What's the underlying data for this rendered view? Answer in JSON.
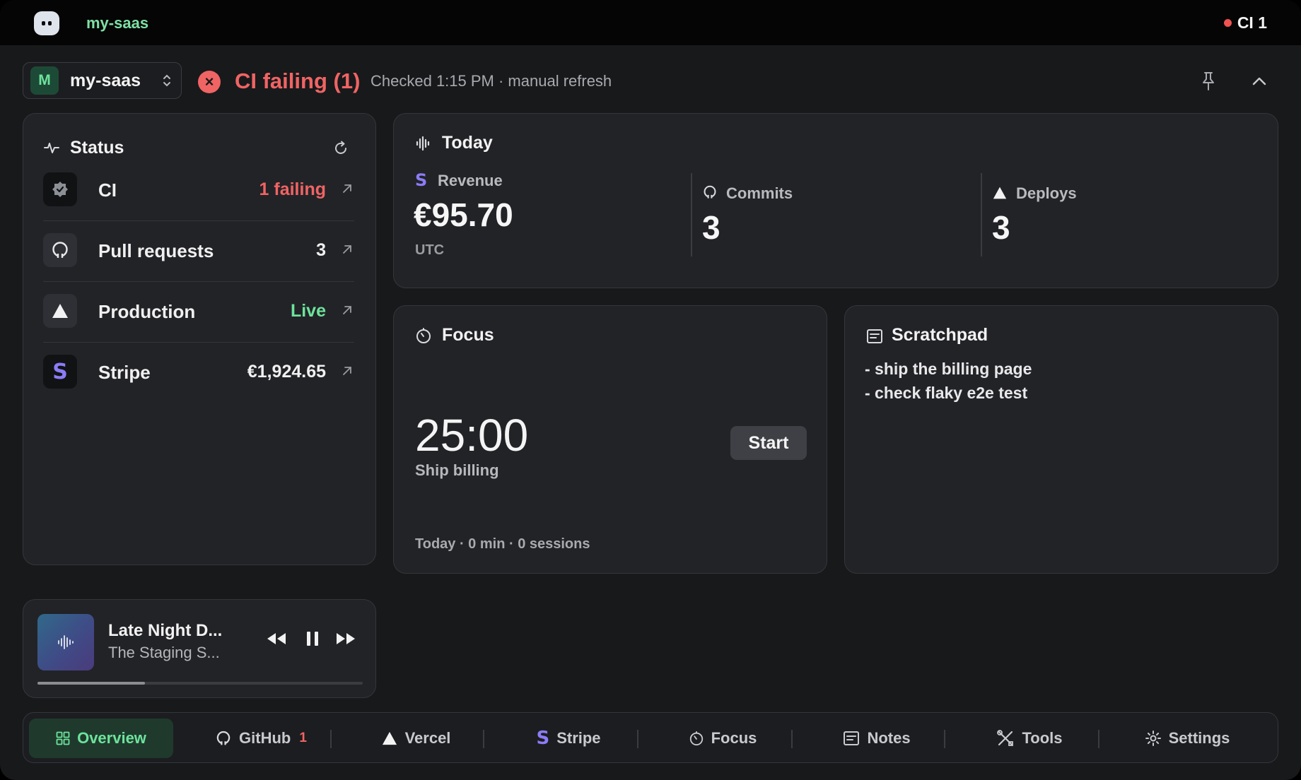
{
  "titlebar": {
    "app_name": "my-saas",
    "ci_indicator": "CI 1"
  },
  "project_bar": {
    "avatar_letter": "M",
    "project_name": "my-saas",
    "ci_status": "CI failing (1)",
    "checked": "Checked 1:15 PM · manual refresh"
  },
  "status": {
    "title": "Status",
    "rows": [
      {
        "label": "CI",
        "value": "1 failing",
        "value_color": "#f06464"
      },
      {
        "label": "Pull requests",
        "value": "3",
        "value_color": "#f0f0f0"
      },
      {
        "label": "Production",
        "value": "Live",
        "value_color": "#6de39c"
      },
      {
        "label": "Stripe",
        "value": "€1,924.65",
        "value_color": "#f0f0f0"
      }
    ]
  },
  "today": {
    "title": "Today",
    "revenue": {
      "label": "Revenue",
      "value": "€95.70",
      "sub": "UTC"
    },
    "commits": {
      "label": "Commits",
      "value": "3"
    },
    "deploys": {
      "label": "Deploys",
      "value": "3"
    }
  },
  "focus": {
    "title": "Focus",
    "timer": "25:00",
    "task": "Ship billing",
    "start_label": "Start",
    "stats": "Today · 0 min · 0 sessions"
  },
  "scratchpad": {
    "title": "Scratchpad",
    "lines": [
      "- ship the billing page",
      "- check flaky e2e test"
    ]
  },
  "player": {
    "title": "Late Night D...",
    "artist": "The Staging S...",
    "progress_fraction": 0.33
  },
  "nav": {
    "items": [
      {
        "label": "Overview",
        "icon": "grid-icon",
        "active": true
      },
      {
        "label": "GitHub",
        "icon": "github-icon",
        "badge": "1"
      },
      {
        "label": "Vercel",
        "icon": "triangle-icon"
      },
      {
        "label": "Stripe",
        "icon": "stripe-icon"
      },
      {
        "label": "Focus",
        "icon": "timer-icon"
      },
      {
        "label": "Notes",
        "icon": "notes-icon"
      },
      {
        "label": "Tools",
        "icon": "tools-icon"
      },
      {
        "label": "Settings",
        "icon": "gear-icon"
      }
    ]
  },
  "colors": {
    "accent_green": "#6de39c",
    "error_red": "#f06464",
    "stripe_purple": "#8b7cf6"
  }
}
